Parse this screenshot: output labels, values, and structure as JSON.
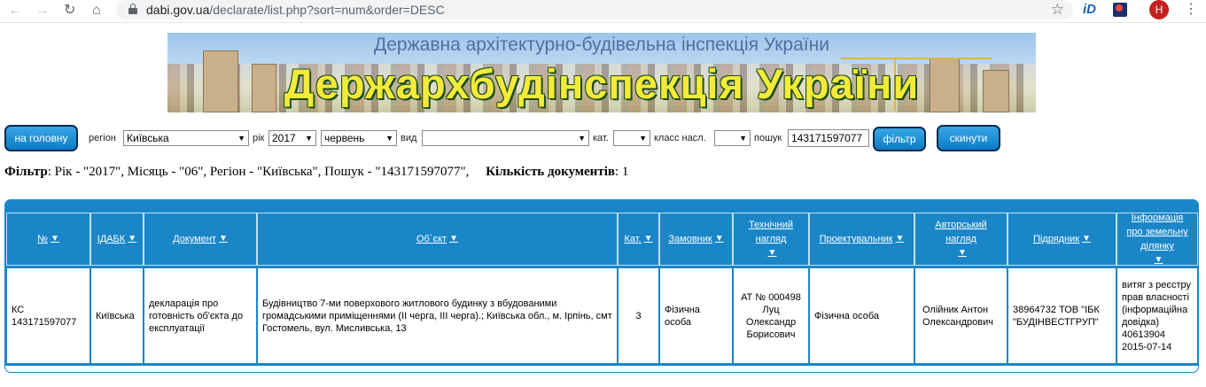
{
  "browser": {
    "url_host": "dabi.gov.ua",
    "url_path": "/declarate/list.php?sort=num&order=DESC",
    "ext1_label": "iD",
    "avatar_letter": "H"
  },
  "banner": {
    "subtitle": "Державна архітектурно-будівельна інспекція України",
    "title": "Держархбудінспекція України"
  },
  "filters": {
    "home_button": "на головну",
    "region_label": "регіон",
    "region_value": "Київська",
    "year_label": "рік",
    "year_value": "2017",
    "month_value": "червень",
    "type_label": "вид",
    "type_value": "",
    "cat_label": "кат.",
    "cat_value": "",
    "class_label": "класс насл.",
    "class_value": "",
    "search_label": "пошук",
    "search_value": "143171597077",
    "filter_button": "фільтр",
    "reset_button": "скинути"
  },
  "filter_summary": {
    "filter_label": "Фільтр",
    "filter_text": ": Рік - \"2017\", Місяць - \"06\", Регіон - \"Київська\", Пошук - \"143171597077\",",
    "count_label": "Кількість документів",
    "count_value": ": 1"
  },
  "table": {
    "columns": [
      "№",
      "ІДАБК",
      "Документ",
      "Об`єкт",
      "Кат.",
      "Замовник",
      "Технічний нагляд",
      "Проектувальник",
      "Авторський нагляд",
      "Підрядник",
      "Інформація про земельну ділянку"
    ],
    "rows": [
      {
        "num": "КС 143171597077",
        "idabk": "Київська",
        "document": "декларація про готовність об'єкта до експлуатації",
        "object": "Будівництво 7-ми поверхового житлового будинку з вбудованими громадськими приміщеннями (ІІ черга, ІІІ черга).; Київська обл., м. Ірпінь, смт Гостомель, вул. Мисливська, 13",
        "cat": "3",
        "customer": "Фізична особа",
        "tech_supervision": "АТ № 000498 Луц Олександр Борисович",
        "designer": "Фізична особа",
        "author_supervision": "Олійник Антон Олександрович",
        "contractor": "38964732 ТОВ \"ІБК \"БУДІНВЕСТГРУП\"",
        "land_info": "витяг з реєстру прав власності (інформаційна довідка) 40613904 2015-07-14"
      }
    ]
  },
  "colors": {
    "accent": "#1a86c8",
    "button": "#0b7cc6",
    "banner_title": "#f4ea3a"
  }
}
